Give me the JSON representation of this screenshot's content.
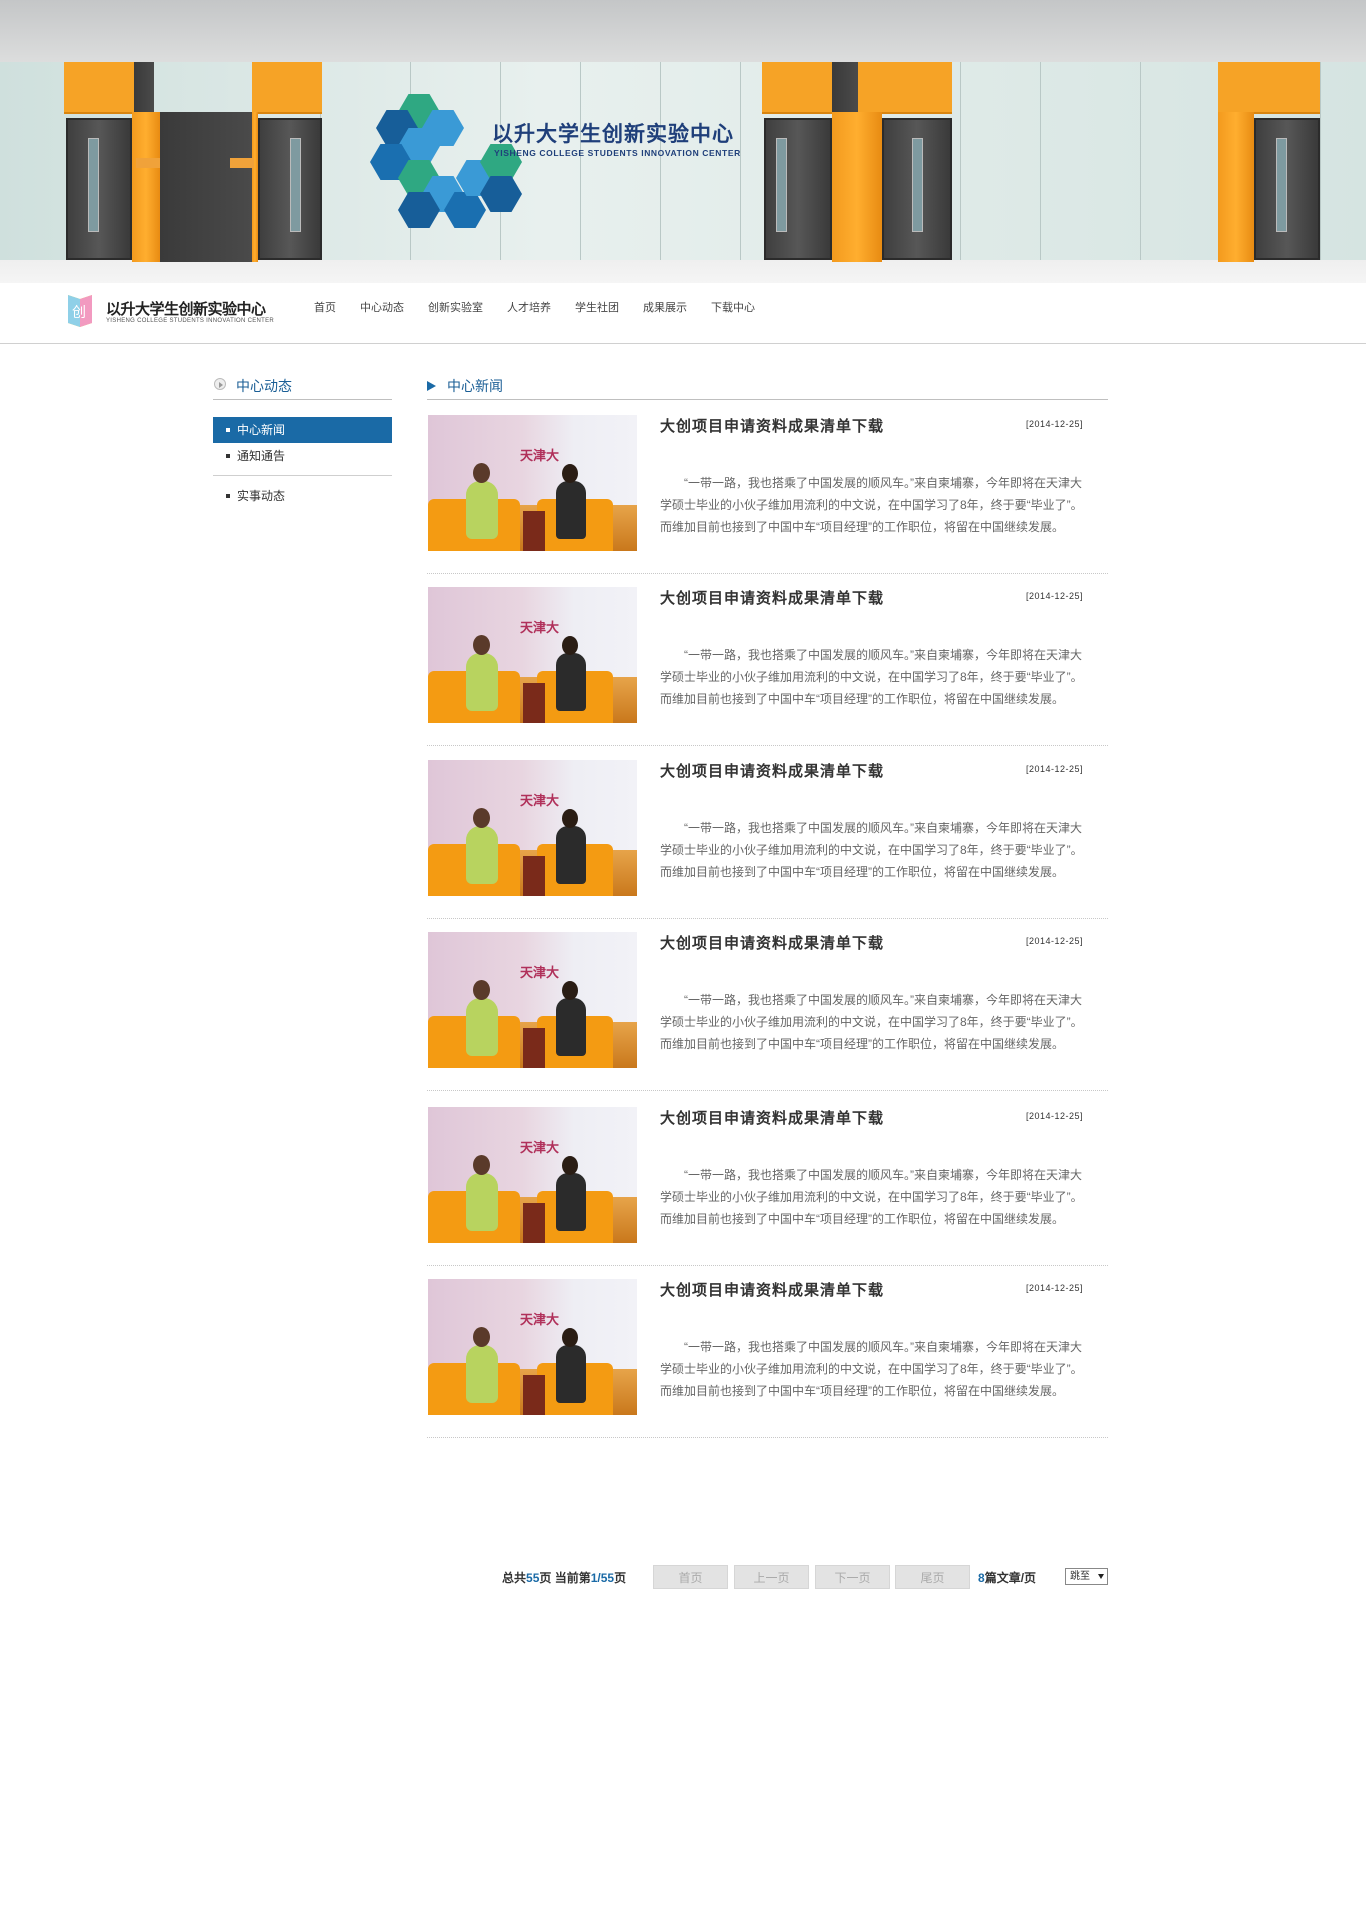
{
  "banner": {
    "title": "以升大学生创新实验中心",
    "subtitle": "YISHENG COLLEGE STUDENTS INNOVATION CENTER"
  },
  "header": {
    "logo_title": "以升大学生创新实验中心",
    "logo_subtitle": "YISHENG COLLEGE STUDENTS INNOVATION CENTER",
    "nav": [
      "首页",
      "中心动态",
      "创新实验室",
      "人才培养",
      "学生社团",
      "成果展示",
      "下载中心"
    ]
  },
  "sidebar": {
    "title": "中心动态",
    "items": [
      {
        "label": "中心新闻",
        "active": true
      },
      {
        "label": "通知通告",
        "active": false
      },
      {
        "label": "实事动态",
        "active": false
      }
    ]
  },
  "content": {
    "title": "中心新闻",
    "news": [
      {
        "title": "大创项目申请资料成果清单下载",
        "date": "[2014-12-25]",
        "desc": "“一带一路，我也搭乘了中国发展的顺风车。”来自柬埔寨，今年即将在天津大学硕士毕业的小伙子维加用流利的中文说，在中国学习了8年，终于要“毕业了”。而维加目前也接到了中国中车“项目经理”的工作职位，将留在中国继续发展。"
      },
      {
        "title": "大创项目申请资料成果清单下载",
        "date": "[2014-12-25]",
        "desc": "“一带一路，我也搭乘了中国发展的顺风车。”来自柬埔寨，今年即将在天津大学硕士毕业的小伙子维加用流利的中文说，在中国学习了8年，终于要“毕业了”。而维加目前也接到了中国中车“项目经理”的工作职位，将留在中国继续发展。"
      },
      {
        "title": "大创项目申请资料成果清单下载",
        "date": "[2014-12-25]",
        "desc": "“一带一路，我也搭乘了中国发展的顺风车。”来自柬埔寨，今年即将在天津大学硕士毕业的小伙子维加用流利的中文说，在中国学习了8年，终于要“毕业了”。而维加目前也接到了中国中车“项目经理”的工作职位，将留在中国继续发展。"
      },
      {
        "title": "大创项目申请资料成果清单下载",
        "date": "[2014-12-25]",
        "desc": "“一带一路，我也搭乘了中国发展的顺风车。”来自柬埔寨，今年即将在天津大学硕士毕业的小伙子维加用流利的中文说，在中国学习了8年，终于要“毕业了”。而维加目前也接到了中国中车“项目经理”的工作职位，将留在中国继续发展。"
      },
      {
        "title": "大创项目申请资料成果清单下载",
        "date": "[2014-12-25]",
        "desc": "“一带一路，我也搭乘了中国发展的顺风车。”来自柬埔寨，今年即将在天津大学硕士毕业的小伙子维加用流利的中文说，在中国学习了8年，终于要“毕业了”。而维加目前也接到了中国中车“项目经理”的工作职位，将留在中国继续发展。"
      },
      {
        "title": "大创项目申请资料成果清单下载",
        "date": "[2014-12-25]",
        "desc": "“一带一路，我也搭乘了中国发展的顺风车。”来自柬埔寨，今年即将在天津大学硕士毕业的小伙子维加用流利的中文说，在中国学习了8年，终于要“毕业了”。而维加目前也接到了中国中车“项目经理”的工作职位，将留在中国继续发展。"
      }
    ],
    "thumb_logo": "天津大"
  },
  "pager": {
    "total_prefix": "总共",
    "total_pages": "55",
    "total_suffix": "页",
    "current_prefix": "当前第",
    "current": "1/55",
    "current_suffix": "页",
    "first": "首页",
    "prev": "上一页",
    "next": "下一页",
    "last": "尾页",
    "per_page_count": "8",
    "per_page_suffix": "篇文章/页",
    "jump_value": "跳至"
  },
  "colors": {
    "accent": "#1a6aa6",
    "orange": "#f6a326"
  }
}
